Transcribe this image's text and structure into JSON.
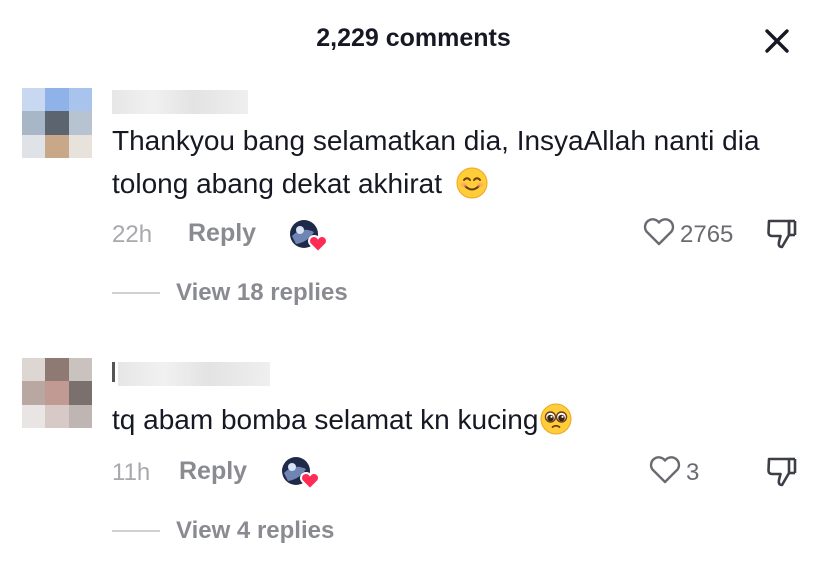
{
  "header": {
    "title": "2,229 comments",
    "close_icon": "close-icon"
  },
  "comments": [
    {
      "text": "Thankyou bang selamatkan dia, InsyaAllah nanti dia tolong abang dekat akhirat",
      "emoji": "smiling-face-emoji",
      "time": "22h",
      "reply_label": "Reply",
      "creator_liked": true,
      "likes": "2765",
      "view_replies": "View 18 replies"
    },
    {
      "text": "tq abam bomba selamat kn kucing",
      "emoji": "pleading-face-emoji",
      "time": "11h",
      "reply_label": "Reply",
      "creator_liked": true,
      "likes": "3",
      "view_replies": "View 4 replies"
    }
  ],
  "colors": {
    "text": "#161823",
    "muted": "#8a8b91",
    "heart_accent": "#fe2c55"
  }
}
